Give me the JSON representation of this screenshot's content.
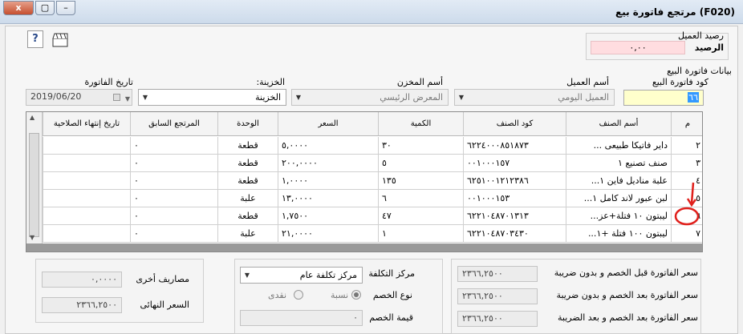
{
  "window": {
    "title": "(F020)  مرتجع فاتورة بيع",
    "close_label": "x",
    "maximize_label": "▢",
    "minimize_label": "–"
  },
  "customer_balance": {
    "title": "رصيد العميل",
    "label": "الرصيد",
    "value": "٠,٠٠"
  },
  "invoice": {
    "section_title": "بيانات فاتورة البيع",
    "code_label": "كود فاتورة البيع",
    "code_value": "٦٦",
    "customer_label": "أسم العميل",
    "customer_value": "العميل اليومي",
    "store_label": "أسم المخزن",
    "store_value": "المعرض الرئيسي",
    "treasury_label": "الخزينة:",
    "treasury_value": "الخزينة",
    "date_label": "تاريخ الفاتورة",
    "date_value": "2019/06/20"
  },
  "grid": {
    "columns": [
      "م",
      "أسم الصنف",
      "كود الصنف",
      "الكمية",
      "السعر",
      "الوحدة",
      "المرتجع السابق",
      "تاريخ إنتهاء الصلاحية"
    ],
    "rows": [
      {
        "num": "٢",
        "name": "داير فاتيكا  طبيعى ...",
        "code": "٦٢٢٤٠٠٠٨٥١٨٧٣",
        "qty": "٣٠",
        "price": "٥,٠٠٠٠",
        "unit": "قطعة",
        "prev": "٠",
        "expiry": ""
      },
      {
        "num": "٣",
        "name": "صنف تصنيع ١",
        "code": "٠٠١٠٠٠١٥٧",
        "qty": "٥",
        "price": "٢٠٠,٠٠٠٠",
        "unit": "قطعة",
        "prev": "٠",
        "expiry": ""
      },
      {
        "num": "٤",
        "name": "علبة مناديل فاين ١...",
        "code": "٦٢٥١٠٠١٢١٢٣٨٦",
        "qty": "١٣٥",
        "price": "١,٠٠٠٠",
        "unit": "قطعة",
        "prev": "٠",
        "expiry": ""
      },
      {
        "num": "٥",
        "name": "لبن عبور لاند كامل ١...",
        "code": "٠٠١٠٠٠١٥٣",
        "qty": "٦",
        "price": "١٣,٠٠٠٠",
        "unit": "علبة",
        "prev": "٠",
        "expiry": ""
      },
      {
        "num": "٦",
        "name": "ليبتون ١٠ فتلة+عز...",
        "code": "٦٢٢١٠٤٨٧٠١٣١٣",
        "qty": "٤٧",
        "price": "١,٧٥٠٠",
        "unit": "قطعة",
        "prev": "٠",
        "expiry": ""
      },
      {
        "num": "٧",
        "name": "ليبتون ١٠٠ فتلة +١...",
        "code": "٦٢٢١٠٤٨٧٠٣٤٣٠",
        "qty": "١",
        "price": "٢١,٠٠٠٠",
        "unit": "علبة",
        "prev": "٠",
        "expiry": ""
      }
    ]
  },
  "totals": {
    "before_discount_label": "سعر الفاتورة قبل الخصم و بدون ضريبة",
    "before_discount_value": "٢٣٦٦,٢٥٠٠",
    "after_discount_label": "سعر الفاتورة بعد الخصم و بدون ضريبة",
    "after_discount_value": "٢٣٦٦,٢٥٠٠",
    "after_tax_label": "سعر الفاتورة بعد الخصم و بعد الضريبة",
    "after_tax_value": "٢٣٦٦,٢٥٠٠"
  },
  "discount": {
    "cost_center_label": "مركز التكلفة",
    "cost_center_value": "مركز تكلفة عام",
    "type_label": "نوع الخصم",
    "percent_label": "نسبة",
    "cash_label": "نقدى",
    "value_label": "قيمة الخصم",
    "value": "٠"
  },
  "expenses": {
    "other_label": "مصاريف أخرى",
    "other_value": "٠,٠٠٠٠",
    "final_label": "السعر النهائى",
    "final_value": "٢٣٦٦,٢٥٠٠"
  },
  "colors": {
    "code_highlight": "#ffffcc",
    "balance_highlight": "#ffdde0",
    "annotation": "#e0201c"
  }
}
